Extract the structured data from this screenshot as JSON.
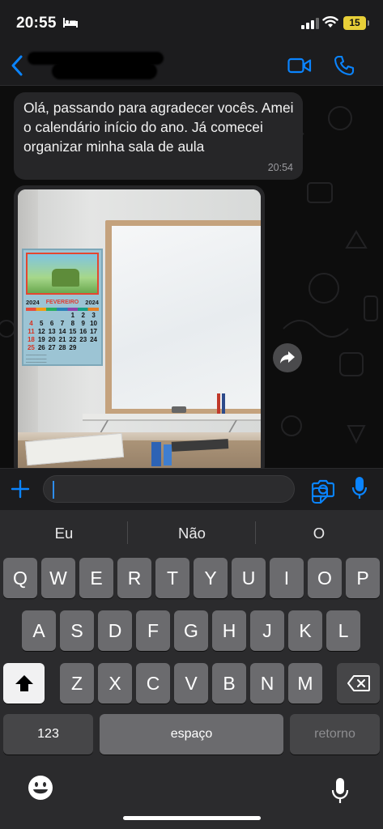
{
  "status_bar": {
    "time": "20:55",
    "battery": "15",
    "icons": [
      "bed-icon",
      "signal-icon",
      "wifi-icon",
      "battery-icon"
    ]
  },
  "header": {
    "contact_name_redacted": true,
    "icons": [
      "back-chevron-icon",
      "video-call-icon",
      "phone-call-icon"
    ],
    "accent_color": "#0a84ff"
  },
  "messages": [
    {
      "type": "text",
      "text": "Olá, passando para agradecer vocês. Amei o calendário início do ano. Já comecei organizar minha sala de aula",
      "time": "20:54"
    },
    {
      "type": "image",
      "description_icon": "photo-classroom",
      "calendar": {
        "year_left": "2024",
        "month": "FEVEREIRO",
        "year_right": "2024",
        "days": [
          "",
          "",
          "",
          "",
          "1",
          "2",
          "3",
          "4",
          "5",
          "6",
          "7",
          "8",
          "9",
          "10",
          "11",
          "12",
          "13",
          "14",
          "15",
          "16",
          "17",
          "18",
          "19",
          "20",
          "21",
          "22",
          "23",
          "24",
          "25",
          "26",
          "27",
          "28",
          "29",
          "",
          ""
        ]
      }
    }
  ],
  "input": {
    "value": "",
    "placeholder": ""
  },
  "keyboard": {
    "suggestions": [
      "Eu",
      "Não",
      "O"
    ],
    "row1": [
      "Q",
      "W",
      "E",
      "R",
      "T",
      "Y",
      "U",
      "I",
      "O",
      "P"
    ],
    "row2": [
      "A",
      "S",
      "D",
      "F",
      "G",
      "H",
      "J",
      "K",
      "L"
    ],
    "row3": [
      "Z",
      "X",
      "C",
      "V",
      "B",
      "N",
      "M"
    ],
    "numbers_key": "123",
    "space_key": "espaço",
    "return_key": "retorno"
  },
  "colors": {
    "background": "#0b0b0b",
    "bubble": "#262628",
    "accent": "#0a84ff",
    "keyboard": "#2b2b2d",
    "battery": "#e7cf38"
  }
}
